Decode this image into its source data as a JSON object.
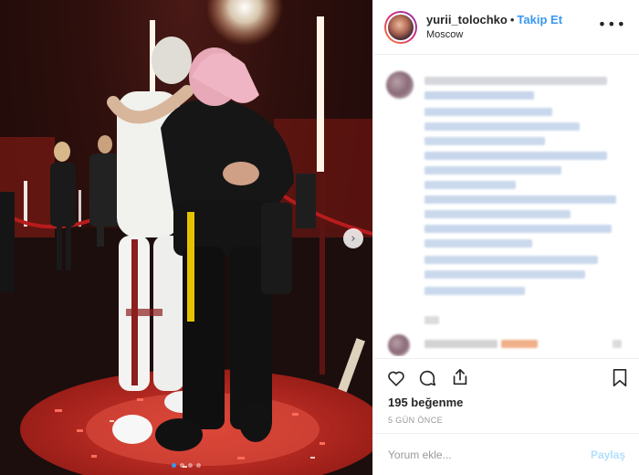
{
  "post": {
    "username": "yurii_tolochko",
    "separator": "•",
    "follow_label": "Takip Et",
    "location": "Moscow",
    "more_icon": "more-horizontal-icon",
    "likes_text": "195 beğenme",
    "time_ago": "5 GÜN ÖNCE"
  },
  "media": {
    "next_icon": "chevron-right-icon",
    "next_glyph": "›",
    "carousel_count": 4,
    "carousel_active": 1
  },
  "comment_box": {
    "placeholder": "Yorum ekle...",
    "share_label": "Paylaş"
  },
  "actions": {
    "icons": [
      "heart-icon",
      "comment-icon",
      "share-icon",
      "bookmark-icon"
    ]
  },
  "colors": {
    "accent": "#3897f0",
    "share_disabled": "#b2dffc",
    "text": "#262626",
    "muted": "#999999"
  }
}
